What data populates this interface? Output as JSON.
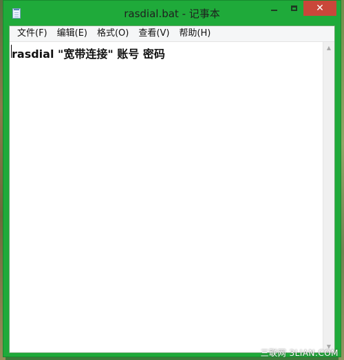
{
  "window": {
    "title": "rasdial.bat - 记事本",
    "close_glyph": "✕"
  },
  "menu": {
    "items": [
      {
        "label": "文件(F)"
      },
      {
        "label": "编辑(E)"
      },
      {
        "label": "格式(O)"
      },
      {
        "label": "查看(V)"
      },
      {
        "label": "帮助(H)"
      }
    ]
  },
  "editor": {
    "content": "rasdial \"宽带连接\" 账号 密码"
  },
  "scrollbar": {
    "up_arrow": "▲",
    "down_arrow": "▼"
  },
  "watermark": {
    "text": "三联网 3LIAN.COM"
  },
  "colors": {
    "titlebar": "#1faa3a",
    "close_button": "#c9473a"
  }
}
